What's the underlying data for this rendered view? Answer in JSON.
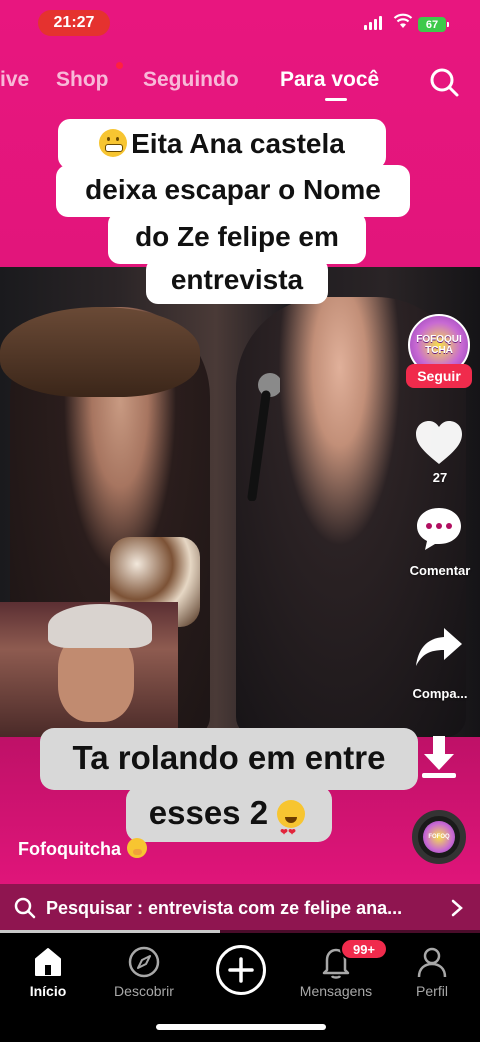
{
  "status_bar": {
    "time": "21:27",
    "battery": "67"
  },
  "top_tabs": {
    "live": "ive",
    "shop": "Shop",
    "following": "Seguindo",
    "for_you": "Para você"
  },
  "caption_top": {
    "line1": "Eita Ana castela",
    "line2": "deixa escapar o Nome",
    "line3": "do Ze felipe em",
    "line4": "entrevista"
  },
  "caption_bottom": {
    "line1": "Ta rolando em entre",
    "line2": "esses 2"
  },
  "creator": {
    "avatar_text": "FOFOQUITCHA",
    "follow_label": "Seguir",
    "username": "Fofoquitcha"
  },
  "actions": {
    "likes": "27",
    "comment_label": "Comentar",
    "share_label": "Compa..."
  },
  "search_suggestion": {
    "text": "Pesquisar : entrevista com ze felipe ana..."
  },
  "bottom_nav": {
    "home": "Início",
    "discover": "Descobrir",
    "messages": "Mensagens",
    "messages_badge": "99+",
    "profile": "Perfil"
  },
  "colors": {
    "brand_pink": "#e8167f",
    "follow_red": "#f02b4c",
    "battery_green": "#3ec94a"
  }
}
